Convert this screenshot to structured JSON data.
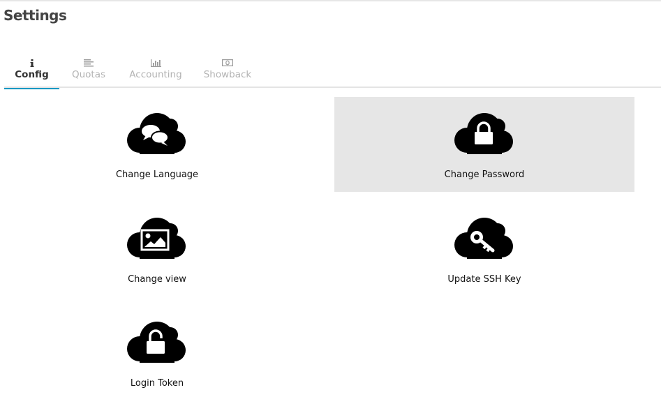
{
  "page": {
    "title": "Settings"
  },
  "tabs": [
    {
      "label": "Config",
      "icon": "info-icon",
      "active": true
    },
    {
      "label": "Quotas",
      "icon": "align-left-icon",
      "active": false
    },
    {
      "label": "Accounting",
      "icon": "bar-chart-icon",
      "active": false
    },
    {
      "label": "Showback",
      "icon": "money-icon",
      "active": false
    }
  ],
  "tiles": [
    {
      "label": "Change Language",
      "icon": "speech-bubbles-icon",
      "highlighted": false
    },
    {
      "label": "Change Password",
      "icon": "lock-icon",
      "highlighted": true
    },
    {
      "label": "Change view",
      "icon": "picture-icon",
      "highlighted": false
    },
    {
      "label": "Update SSH Key",
      "icon": "key-icon",
      "highlighted": false
    },
    {
      "label": "Login Token",
      "icon": "unlock-icon",
      "highlighted": false
    }
  ],
  "colors": {
    "tab_active_underline": "#0098c3",
    "highlight_bg": "#e6e6e6",
    "cloud": "#000000"
  }
}
